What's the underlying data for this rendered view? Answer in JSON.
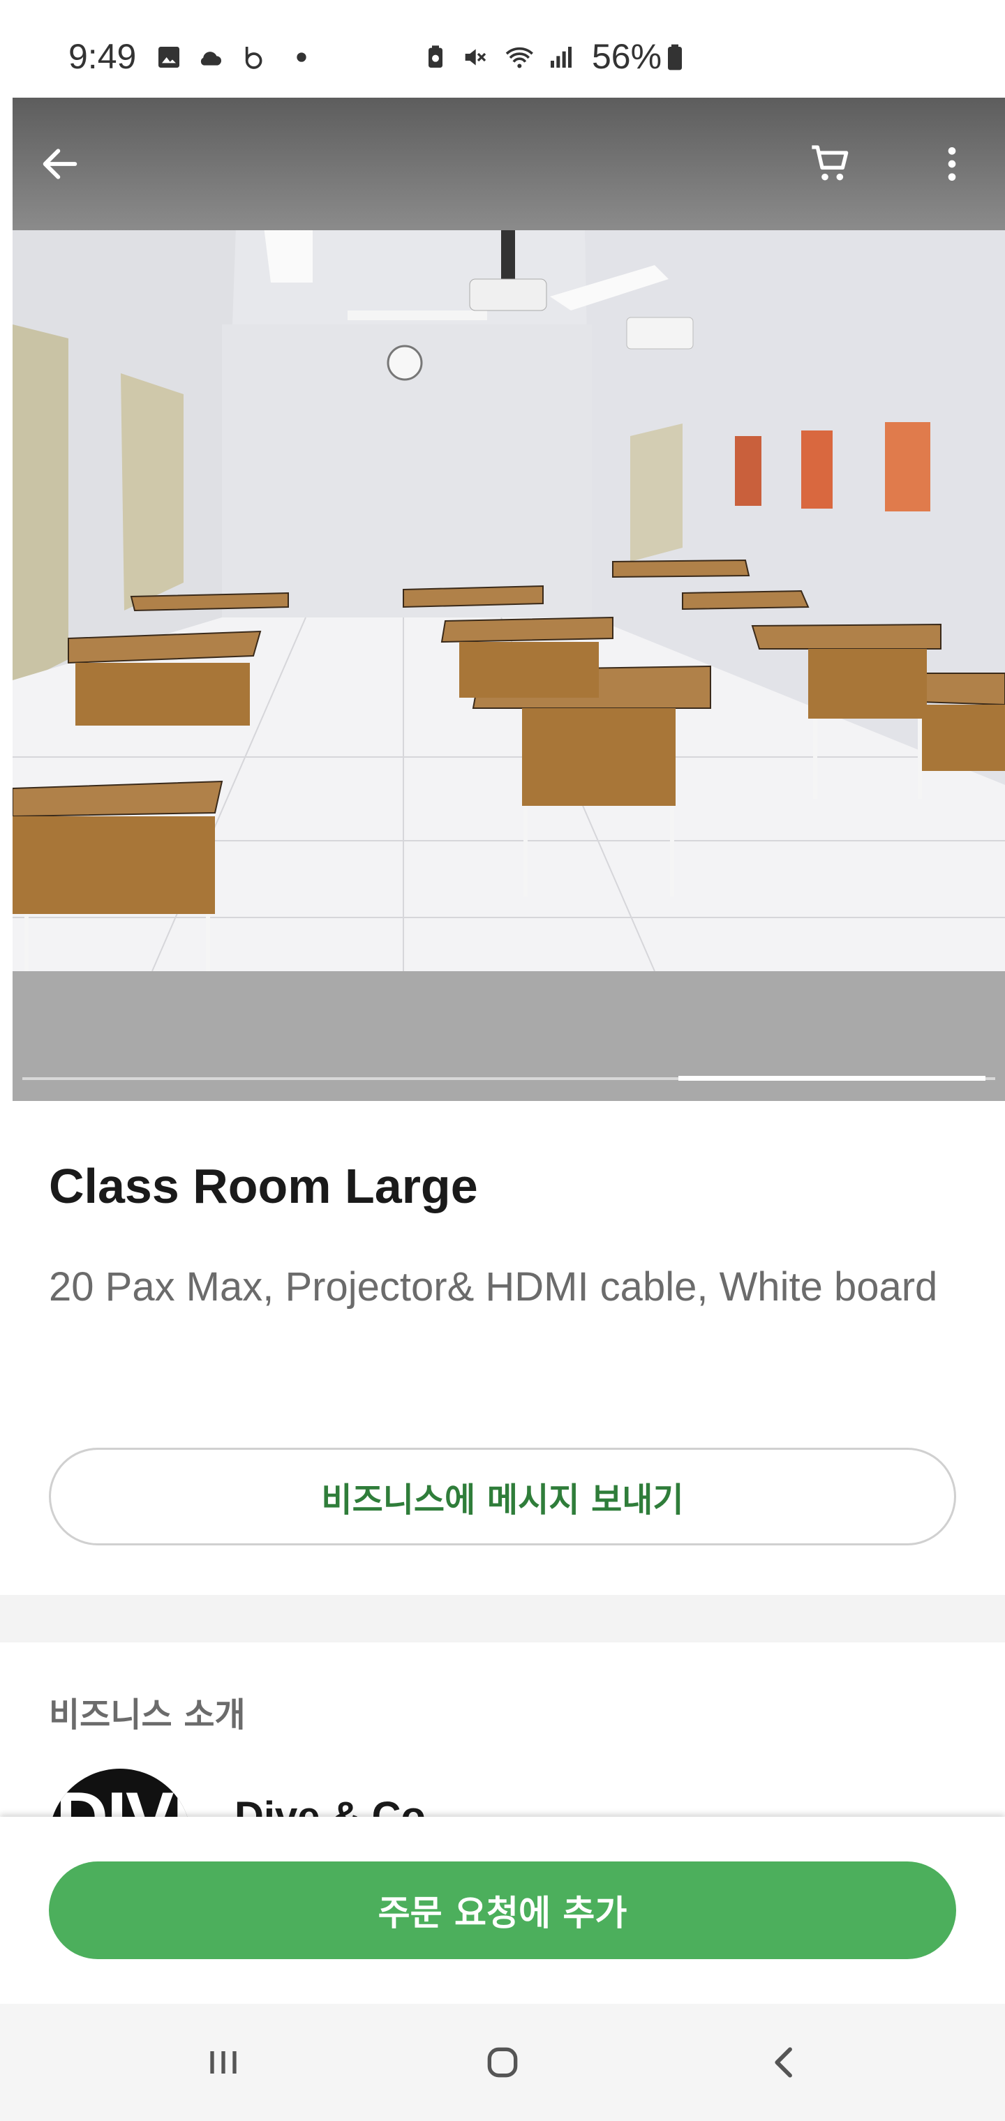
{
  "status_bar": {
    "time": "9:49",
    "battery": "56%",
    "icons": [
      "gallery-icon",
      "cloud-icon",
      "b-app-icon",
      "dot-icon",
      "battery-saver-icon",
      "mute-icon",
      "wifi-icon",
      "signal-icon",
      "battery-icon"
    ]
  },
  "hero": {
    "image_alt": "classroom with desks",
    "carousel": {
      "active_index": 2,
      "total": 3
    }
  },
  "toolbar": {
    "back_icon": "arrow-left-icon",
    "cart_icon": "cart-icon",
    "more_icon": "more-vert-icon"
  },
  "product": {
    "title": "Class Room Large",
    "description": "20 Pax Max, Projector& HDMI cable, White board"
  },
  "message_button": {
    "label": "비즈니스에 메시지 보내기"
  },
  "business_section": {
    "title": "비즈니스 소개",
    "logo_text": "DIVE",
    "name": "Dive & Co"
  },
  "primary_button": {
    "label": "주문 요청에 추가"
  },
  "nav_bar": {
    "recents_icon": "recents-icon",
    "home_icon": "home-icon",
    "back_icon": "nav-back-icon"
  },
  "colors": {
    "accent_green": "#4caf5c",
    "link_green": "#2f7d3a"
  }
}
